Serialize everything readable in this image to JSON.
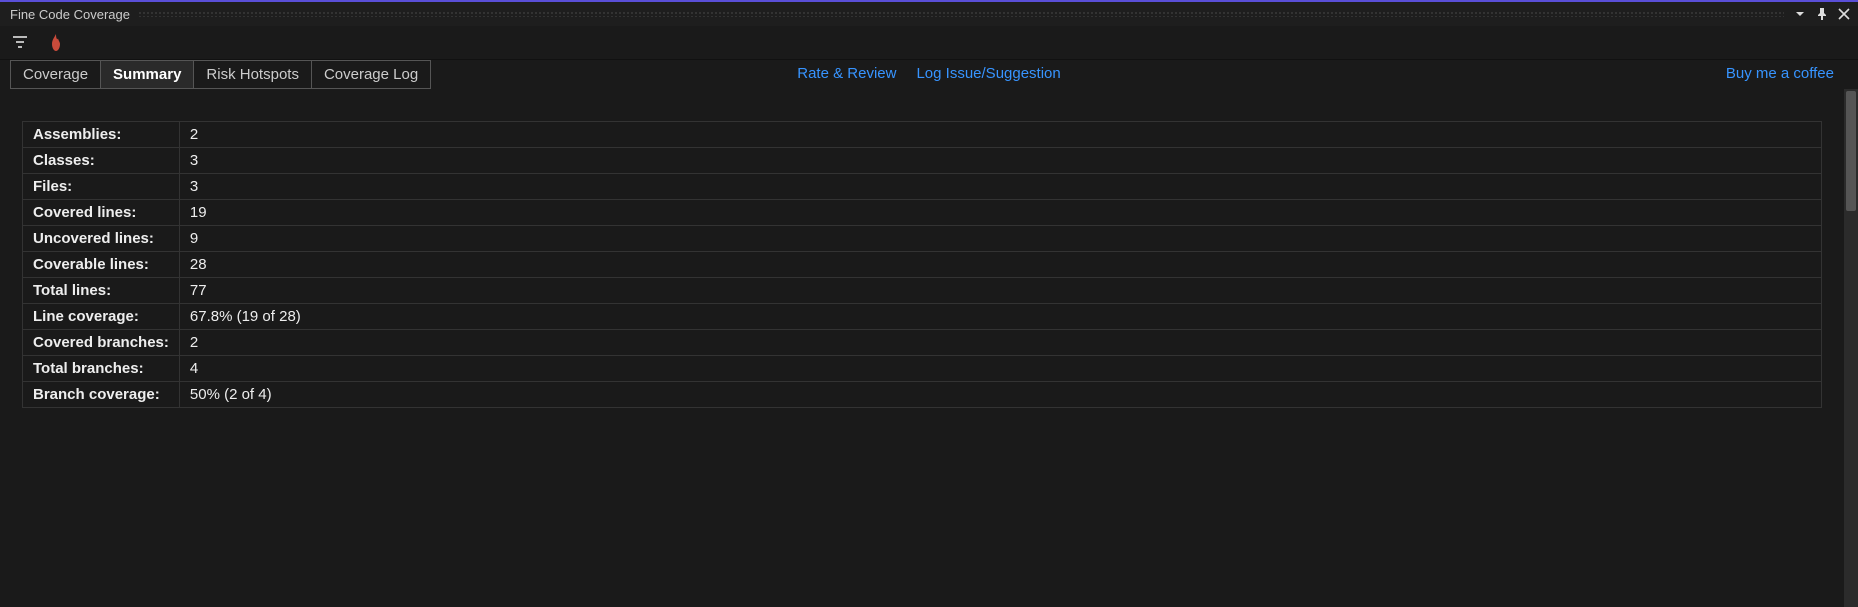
{
  "window": {
    "title": "Fine Code Coverage"
  },
  "tabs": [
    {
      "label": "Coverage",
      "active": false
    },
    {
      "label": "Summary",
      "active": true
    },
    {
      "label": "Risk Hotspots",
      "active": false
    },
    {
      "label": "Coverage Log",
      "active": false
    }
  ],
  "links": {
    "rate_review": "Rate & Review",
    "log_issue": "Log Issue/Suggestion",
    "coffee": "Buy me a coffee"
  },
  "summary": [
    {
      "label": "Assemblies:",
      "value": "2"
    },
    {
      "label": "Classes:",
      "value": "3"
    },
    {
      "label": "Files:",
      "value": "3"
    },
    {
      "label": "Covered lines:",
      "value": "19"
    },
    {
      "label": "Uncovered lines:",
      "value": "9"
    },
    {
      "label": "Coverable lines:",
      "value": "28"
    },
    {
      "label": "Total lines:",
      "value": "77"
    },
    {
      "label": "Line coverage:",
      "value": "67.8% (19 of 28)"
    },
    {
      "label": "Covered branches:",
      "value": "2"
    },
    {
      "label": "Total branches:",
      "value": "4"
    },
    {
      "label": "Branch coverage:",
      "value": "50% (2 of 4)"
    }
  ]
}
